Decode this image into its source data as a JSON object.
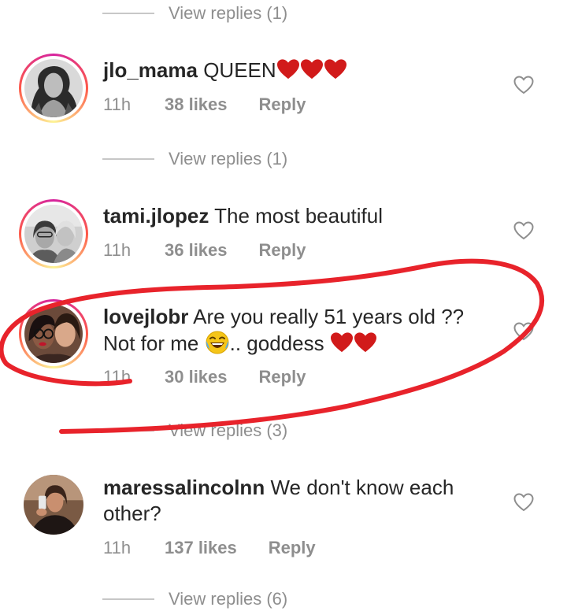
{
  "replies_top": {
    "label": "View replies (1)"
  },
  "comments": [
    {
      "username": "jlo_mama",
      "text": "QUEEN",
      "hearts": 3,
      "time": "11h",
      "likes": "38 likes",
      "reply": "Reply",
      "view_replies": "View replies (1)"
    },
    {
      "username": "tami.jlopez",
      "text": "The most beautiful",
      "time": "11h",
      "likes": "36 likes",
      "reply": "Reply"
    },
    {
      "username": "lovejlobr",
      "text_line1": "Are you really 51 years old ??",
      "text_line2_a": "Not for me",
      "text_line2_b": ".. goddess",
      "time": "11h",
      "likes": "30 likes",
      "reply": "Reply",
      "view_replies": "View replies (3)"
    },
    {
      "username": "maressalincolnn",
      "text_line1": "We don't know each",
      "text_line2": "other?",
      "time": "11h",
      "likes": "137 likes",
      "reply": "Reply",
      "view_replies": "View replies (6)"
    }
  ],
  "colors": {
    "text_primary": "#262626",
    "text_secondary": "#8e8e8e",
    "emoji_heart": "#d11a1a",
    "annotation_ink": "#e8232b"
  },
  "icons": [
    "heart-outline-icon",
    "red-heart-emoji",
    "laughing-emoji"
  ]
}
